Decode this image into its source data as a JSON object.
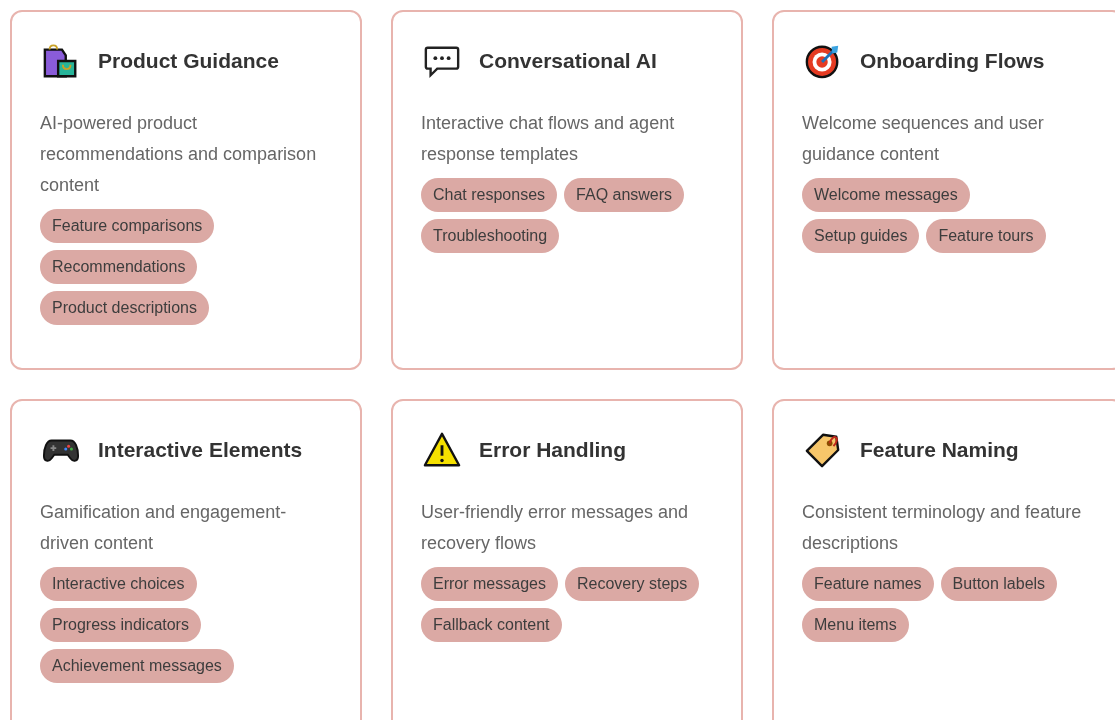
{
  "cards": [
    {
      "title": "Product Guidance",
      "description": "AI-powered product recommendations and comparison content",
      "tags": [
        "Feature comparisons",
        "Recommendations",
        "Product descriptions"
      ]
    },
    {
      "title": "Conversational AI",
      "description": "Interactive chat flows and agent response templates",
      "tags": [
        "Chat responses",
        "FAQ answers",
        "Troubleshooting"
      ]
    },
    {
      "title": "Onboarding Flows",
      "description": "Welcome sequences and user guidance content",
      "tags": [
        "Welcome messages",
        "Setup guides",
        "Feature tours"
      ]
    },
    {
      "title": "Interactive Elements",
      "description": "Gamification and engagement-driven content",
      "tags": [
        "Interactive choices",
        "Progress indicators",
        "Achievement messages"
      ]
    },
    {
      "title": "Error Handling",
      "description": "User-friendly error messages and recovery flows",
      "tags": [
        "Error messages",
        "Recovery steps",
        "Fallback content"
      ]
    },
    {
      "title": "Feature Naming",
      "description": "Consistent terminology and feature descriptions",
      "tags": [
        "Feature names",
        "Button labels",
        "Menu items"
      ]
    }
  ]
}
